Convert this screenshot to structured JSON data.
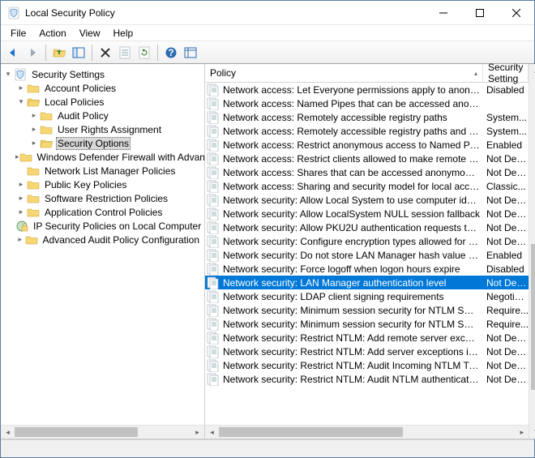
{
  "window": {
    "title": "Local Security Policy"
  },
  "menu": {
    "file": "File",
    "action": "Action",
    "view": "View",
    "help": "Help"
  },
  "tree": {
    "root": "Security Settings",
    "account_policies": "Account Policies",
    "local_policies": "Local Policies",
    "audit_policy": "Audit Policy",
    "user_rights": "User Rights Assignment",
    "security_options": "Security Options",
    "firewall": "Windows Defender Firewall with Advanced Security",
    "nlm": "Network List Manager Policies",
    "pubkey": "Public Key Policies",
    "srp": "Software Restriction Policies",
    "acp": "Application Control Policies",
    "ipsec": "IP Security Policies on Local Computer",
    "aapc": "Advanced Audit Policy Configuration"
  },
  "list": {
    "col1": "Policy",
    "col2": "Security Setting",
    "rows": [
      {
        "p": "Network access: Let Everyone permissions apply to anonym...",
        "s": "Disabled"
      },
      {
        "p": "Network access: Named Pipes that can be accessed anonym...",
        "s": ""
      },
      {
        "p": "Network access: Remotely accessible registry paths",
        "s": "System..."
      },
      {
        "p": "Network access: Remotely accessible registry paths and sub...",
        "s": "System..."
      },
      {
        "p": "Network access: Restrict anonymous access to Named Pipes...",
        "s": "Enabled"
      },
      {
        "p": "Network access: Restrict clients allowed to make remote call...",
        "s": "Not Defined"
      },
      {
        "p": "Network access: Shares that can be accessed anonymously",
        "s": "Not Defined"
      },
      {
        "p": "Network access: Sharing and security model for local accou...",
        "s": "Classic..."
      },
      {
        "p": "Network security: Allow Local System to use computer ident...",
        "s": "Not Defined"
      },
      {
        "p": "Network security: Allow LocalSystem NULL session fallback",
        "s": "Not Defined"
      },
      {
        "p": "Network security: Allow PKU2U authentication requests to t...",
        "s": "Not Defined"
      },
      {
        "p": "Network security: Configure encryption types allowed for Ke...",
        "s": "Not Defined"
      },
      {
        "p": "Network security: Do not store LAN Manager hash value on ...",
        "s": "Enabled"
      },
      {
        "p": "Network security: Force logoff when logon hours expire",
        "s": "Disabled"
      },
      {
        "p": "Network security: LAN Manager authentication level",
        "s": "Not Defined",
        "selected": true
      },
      {
        "p": "Network security: LDAP client signing requirements",
        "s": "Negotiate..."
      },
      {
        "p": "Network security: Minimum session security for NTLM SSP ...",
        "s": "Require..."
      },
      {
        "p": "Network security: Minimum session security for NTLM SSP ...",
        "s": "Require..."
      },
      {
        "p": "Network security: Restrict NTLM: Add remote server excepti...",
        "s": "Not Defined"
      },
      {
        "p": "Network security: Restrict NTLM: Add server exceptions in t...",
        "s": "Not Defined"
      },
      {
        "p": "Network security: Restrict NTLM: Audit Incoming NTLM Traf...",
        "s": "Not Defined"
      },
      {
        "p": "Network security: Restrict NTLM: Audit NTLM authentication...",
        "s": "Not Defined"
      }
    ]
  }
}
